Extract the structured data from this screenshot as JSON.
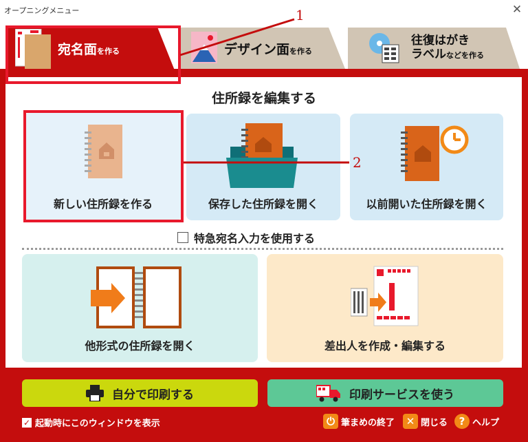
{
  "window": {
    "title": "オープニングメニュー",
    "close_symbol": "✕"
  },
  "tabs": {
    "address": {
      "main": "宛名面",
      "sub": "を作る"
    },
    "design": {
      "main": "デザイン面",
      "sub": "を作る"
    },
    "label": {
      "line1": "往復はがき",
      "line2_main": "ラベル",
      "line2_sub": "などを作る"
    }
  },
  "section": {
    "title": "住所録を編集する"
  },
  "cards": {
    "new": "新しい住所録を作る",
    "open": "保存した住所録を開く",
    "previous": "以前開いた住所録を開く",
    "other_format": "他形式の住所録を開く",
    "sender": "差出人を作成・編集する"
  },
  "quick_address": {
    "label": "特急宛名入力を使用する",
    "checked": false
  },
  "buttons": {
    "print": "自分で印刷する",
    "service": "印刷サービスを使う"
  },
  "footer": {
    "startup_label": "起動時にこのウィンドウを表示",
    "startup_checked": true,
    "exit": "筆まめの終了",
    "close": "閉じる",
    "help": "ヘルプ"
  },
  "annotations": [
    "1",
    "2"
  ],
  "colors": {
    "frame": "#c40d0d",
    "highlight": "#e8192c",
    "tab_inactive": "#d1c5b4",
    "print_button": "#cbd80d",
    "service_button": "#5dc896"
  }
}
